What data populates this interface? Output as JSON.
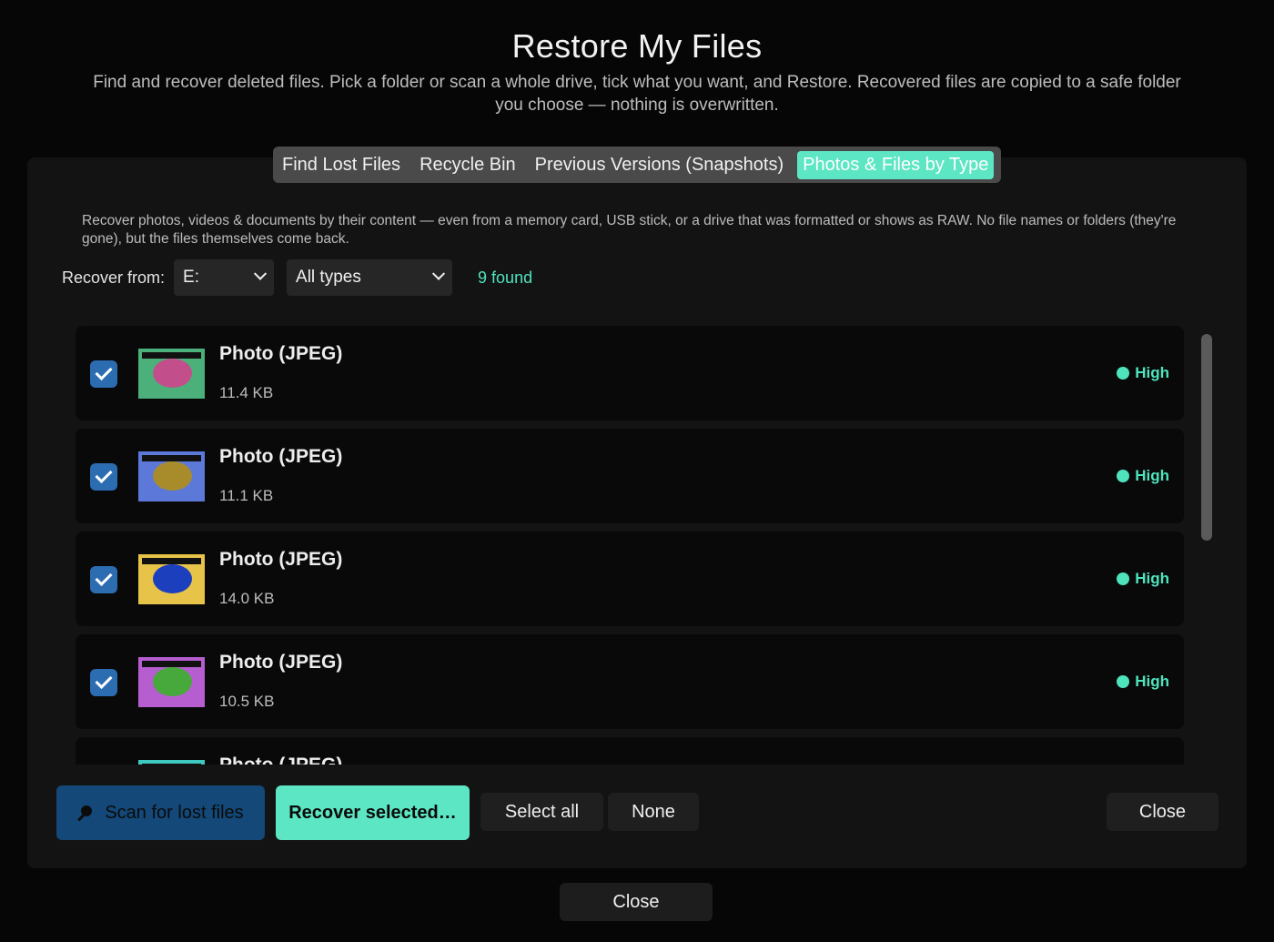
{
  "header": {
    "title": "Restore My Files",
    "subtitle": "Find and recover deleted files. Pick a folder or scan a whole drive, tick what you want, and Restore. Recovered files are copied to a safe folder you choose — nothing is overwritten."
  },
  "tabs": [
    {
      "label": "Find Lost Files",
      "active": false
    },
    {
      "label": "Recycle Bin",
      "active": false
    },
    {
      "label": "Previous Versions (Snapshots)",
      "active": false
    },
    {
      "label": "Photos & Files by Type",
      "active": true
    }
  ],
  "description": "Recover photos, videos & documents by their content — even from a memory card, USB stick, or a drive that was formatted or shows as RAW. No file names or folders (they're gone), but the files themselves come back.",
  "controls": {
    "recover_from_label": "Recover from:",
    "drive_value": "E:",
    "type_value": "All types",
    "found_text": "9 found"
  },
  "files": [
    {
      "name": "Photo (JPEG)",
      "size": "11.4 KB",
      "quality": "High",
      "checked": true,
      "thumb_bg": "#4cb07a",
      "thumb_blob": "#c24f8c"
    },
    {
      "name": "Photo (JPEG)",
      "size": "11.1 KB",
      "quality": "High",
      "checked": true,
      "thumb_bg": "#5c79da",
      "thumb_blob": "#a88c2c"
    },
    {
      "name": "Photo (JPEG)",
      "size": "14.0 KB",
      "quality": "High",
      "checked": true,
      "thumb_bg": "#e8c34a",
      "thumb_blob": "#1c3fbd"
    },
    {
      "name": "Photo (JPEG)",
      "size": "10.5 KB",
      "quality": "High",
      "checked": true,
      "thumb_bg": "#b65ed0",
      "thumb_blob": "#47a93c"
    },
    {
      "name": "Photo (JPEG)",
      "size": "",
      "quality": "",
      "checked": true,
      "thumb_bg": "#3ec9c0",
      "thumb_blob": "#3ec9c0"
    }
  ],
  "buttons": {
    "scan": "Scan for lost files",
    "recover": "Recover selected…",
    "select_all": "Select all",
    "none": "None",
    "close_inner": "Close",
    "close_outer": "Close"
  },
  "colors": {
    "accent": "#5ce6c3",
    "quality_high": "#4fe3bd",
    "scan_button": "#134878",
    "checkbox": "#2c6cb0"
  }
}
